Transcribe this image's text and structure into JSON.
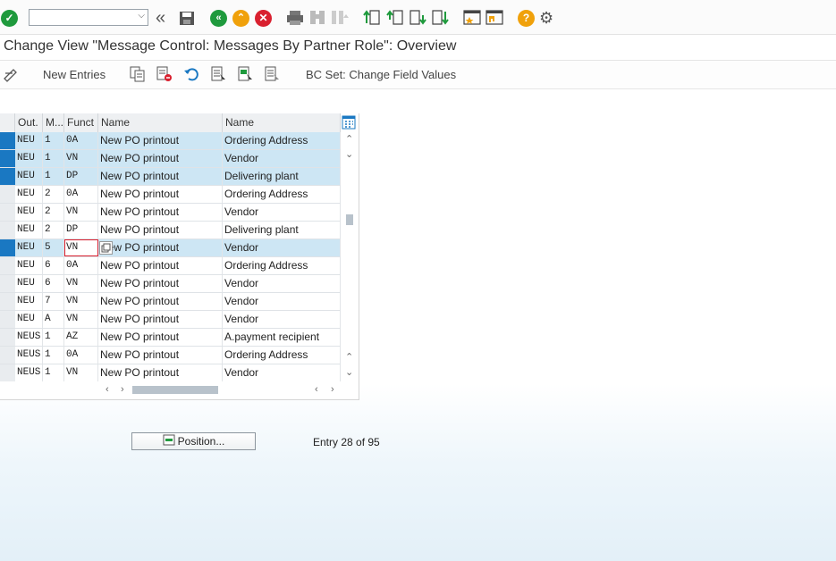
{
  "toolbar": {
    "command_value": "",
    "icons": [
      "enter-icon",
      "back-double-icon",
      "save-icon",
      "back-icon",
      "exit-icon",
      "cancel-icon",
      "print-icon",
      "find-icon",
      "find-next-icon",
      "first-page-icon",
      "previous-page-icon",
      "next-page-icon",
      "last-page-icon",
      "new-window-icon",
      "shortcut-icon",
      "help-icon",
      "settings-icon"
    ]
  },
  "title": "Change View \"Message Control: Messages By Partner Role\": Overview",
  "app_toolbar": {
    "new_entries": "New Entries",
    "bc_set": "BC Set: Change Field Values"
  },
  "table": {
    "headers": [
      "Out.",
      "M...",
      "Funct",
      "Name",
      "Name"
    ],
    "rows": [
      {
        "out": "NEU",
        "m": "1",
        "f": "0A",
        "name": "New PO printout",
        "name2": "Ordering Address",
        "selected": true
      },
      {
        "out": "NEU",
        "m": "1",
        "f": "VN",
        "name": "New PO printout",
        "name2": "Vendor",
        "selected": true
      },
      {
        "out": "NEU",
        "m": "1",
        "f": "DP",
        "name": "New PO printout",
        "name2": "Delivering plant",
        "selected": true
      },
      {
        "out": "NEU",
        "m": "2",
        "f": "0A",
        "name": "New PO printout",
        "name2": "Ordering Address",
        "selected": false
      },
      {
        "out": "NEU",
        "m": "2",
        "f": "VN",
        "name": "New PO printout",
        "name2": "Vendor",
        "selected": false
      },
      {
        "out": "NEU",
        "m": "2",
        "f": "DP",
        "name": "New PO printout",
        "name2": "Delivering plant",
        "selected": false
      },
      {
        "out": "NEU",
        "m": "5",
        "f": "VN",
        "name": "New PO printout",
        "name2": "Vendor",
        "selected": true
      },
      {
        "out": "NEU",
        "m": "6",
        "f": "0A",
        "name": "New PO printout",
        "name2": "Ordering Address",
        "selected": false
      },
      {
        "out": "NEU",
        "m": "6",
        "f": "VN",
        "name": "New PO printout",
        "name2": "Vendor",
        "selected": false
      },
      {
        "out": "NEU",
        "m": "7",
        "f": "VN",
        "name": "New PO printout",
        "name2": "Vendor",
        "selected": false
      },
      {
        "out": "NEU",
        "m": "A",
        "f": "VN",
        "name": "New PO printout",
        "name2": "Vendor",
        "selected": false
      },
      {
        "out": "NEUS",
        "m": "1",
        "f": "AZ",
        "name": "New PO printout",
        "name2": "A.payment recipient",
        "selected": false
      },
      {
        "out": "NEUS",
        "m": "1",
        "f": "0A",
        "name": "New PO printout",
        "name2": "Ordering Address",
        "selected": false
      },
      {
        "out": "NEUS",
        "m": "1",
        "f": "VN",
        "name": "New PO printout",
        "name2": "Vendor",
        "selected": false
      }
    ]
  },
  "position_button": "Position...",
  "entry_info": "Entry 28 of 95",
  "colors": {
    "accent": "#1a78c2",
    "selected_row": "#cde6f4"
  }
}
